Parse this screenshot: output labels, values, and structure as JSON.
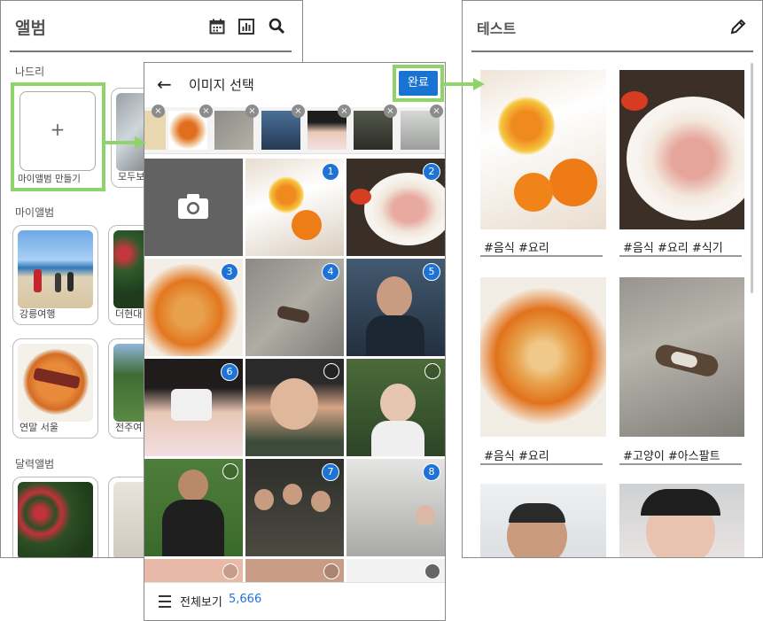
{
  "album_screen": {
    "title": "앨범",
    "section_mine": "나드리",
    "new_album_label": "마이앨범 만들기",
    "partial_card_label": "모두보",
    "section_my_albums": "마이앨범",
    "albums": [
      {
        "label": "강릉여행"
      },
      {
        "label": "더현대"
      },
      {
        "label": "연말 서울"
      },
      {
        "label": "전주여"
      }
    ],
    "section_calendar": "달력앨범",
    "icons": [
      "calendar-icon",
      "chart-icon",
      "search-icon"
    ]
  },
  "picker": {
    "back": "←",
    "title": "이미지 선택",
    "done_label": "완료",
    "remove_glyph": "×",
    "badges": [
      "1",
      "2",
      "3",
      "4",
      "5",
      "6",
      "7",
      "8"
    ],
    "footer_label": "전체보기",
    "footer_count": "5,666"
  },
  "test_album": {
    "title": "테스트",
    "tags": [
      "#음식 #요리",
      "#음식 #요리 #식기",
      "#음식 #요리",
      "#고양이 #아스팔트"
    ]
  },
  "colors": {
    "accent_green": "#8fd46a",
    "button_blue": "#1873d3",
    "badge_blue": "#1e74d6"
  }
}
